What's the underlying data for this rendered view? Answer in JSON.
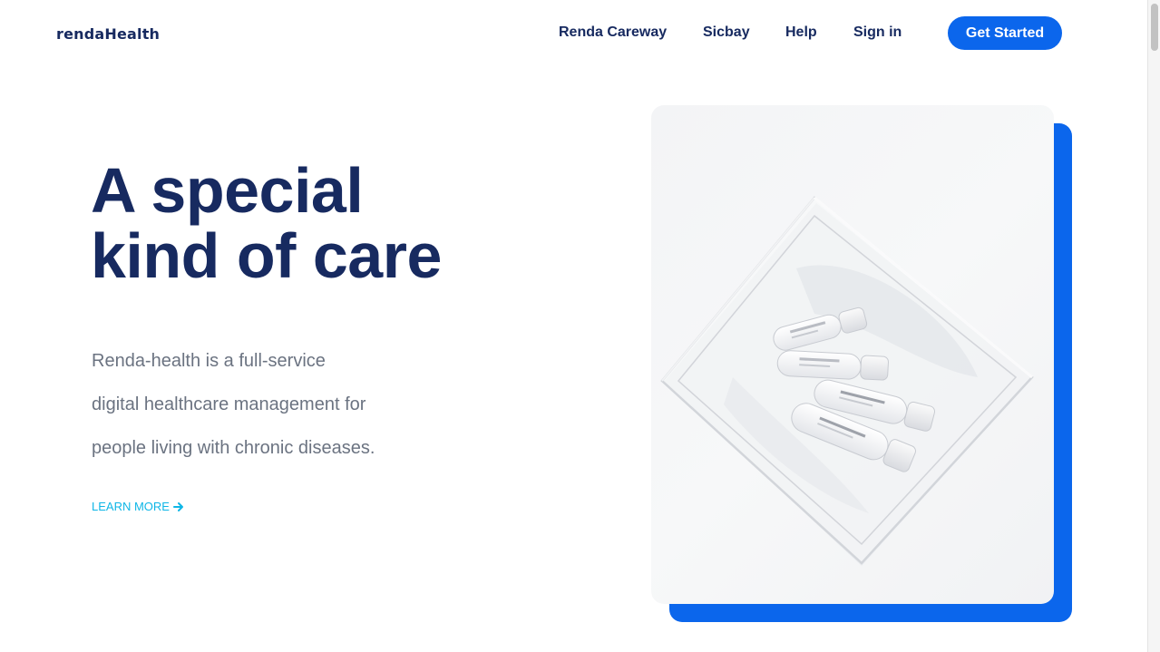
{
  "brand": {
    "name": "rendaHealth"
  },
  "nav": {
    "links": [
      {
        "label": "Renda Careway"
      },
      {
        "label": "Sicbay"
      },
      {
        "label": "Help"
      },
      {
        "label": "Sign in"
      }
    ],
    "cta_label": "Get Started"
  },
  "hero": {
    "headline_lines": [
      "A special",
      "kind of care"
    ],
    "description_lines": [
      "Renda-health is a full-service",
      "digital healthcare management for",
      "people living with chronic diseases."
    ],
    "learn_more_label": "LEARN MORE",
    "image_icon": "medicine-vials-photo"
  },
  "colors": {
    "primary": "#0b66ec",
    "navy": "#172a60",
    "body_text": "#6b7381",
    "link": "#0fb6e6"
  }
}
